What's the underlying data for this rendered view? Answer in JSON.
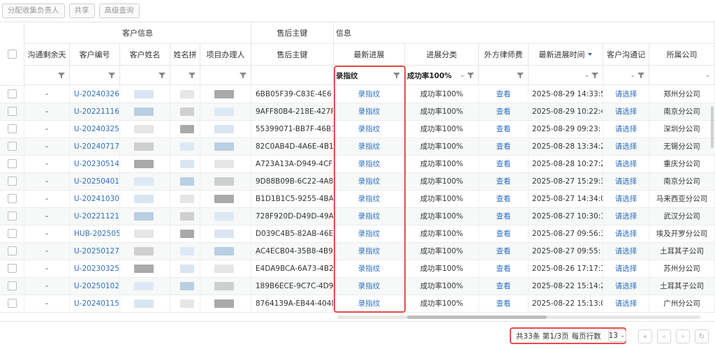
{
  "toolbar": {
    "assign_label": "分配收集负责人",
    "share_label": "共享",
    "advanced_query_label": "高级查询"
  },
  "header": {
    "group_customer": "客户信息",
    "group_aftersale_key": "售后主键",
    "group_info": "信息",
    "columns": {
      "communication_remaining": "沟通剩余天",
      "customer_no": "客户编号",
      "customer_name": "客户姓名",
      "name_pinyin": "姓名拼",
      "project_handler": "项目办理人",
      "aftersale_key": "售后主键",
      "latest_progress": "最新进展",
      "progress_category": "进展分类",
      "lawyer_fee": "外方律师费",
      "latest_progress_time": "最新进展时间",
      "customer_communication": "客户沟通记",
      "company": "所属公司"
    },
    "filters": {
      "latest_progress": "录指纹",
      "progress_category": "成功率100%"
    }
  },
  "rows": [
    {
      "remaining": "-",
      "customer_no": "U-20240326",
      "key": "6BB05F39-C83E-4E6",
      "progress": "录指纹",
      "category": "成功率100%",
      "fee": "查看",
      "time": "2025-08-29 14:33:5",
      "comm": "请选择",
      "company": "郑州分公司"
    },
    {
      "remaining": "-",
      "customer_no": "U-20221116",
      "key": "9AFF80B4-218E-427F",
      "progress": "录指纹",
      "category": "成功率100%",
      "fee": "查看",
      "time": "2025-08-29 10:22:4",
      "comm": "请选择",
      "company": "南京分公司"
    },
    {
      "remaining": "-",
      "customer_no": "U-20240325",
      "key": "55399071-BB7F-46B1",
      "progress": "录指纹",
      "category": "成功率100%",
      "fee": "查看",
      "time": "2025-08-29 09:23:",
      "comm": "请选择",
      "company": "深圳分公司"
    },
    {
      "remaining": "-",
      "customer_no": "U-20240717",
      "key": "82C0AB4D-4A6E-4B1",
      "progress": "录指纹",
      "category": "成功率100%",
      "fee": "查看",
      "time": "2025-08-28 13:34:2",
      "comm": "请选择",
      "company": "无锡分公司"
    },
    {
      "remaining": "-",
      "customer_no": "U-20230514",
      "key": "A723A13A-D949-4CF",
      "progress": "录指纹",
      "category": "成功率100%",
      "fee": "查看",
      "time": "2025-08-28 10:27:2",
      "comm": "请选择",
      "company": "重庆分公司"
    },
    {
      "remaining": "-",
      "customer_no": "U-20250401",
      "key": "9D88B09B-6C22-4A8",
      "progress": "录指纹",
      "category": "成功率100%",
      "fee": "查看",
      "time": "2025-08-27 15:29:3",
      "comm": "请选择",
      "company": "南京分公司"
    },
    {
      "remaining": "-",
      "customer_no": "U-20241030",
      "key": "B1D1B1C5-9255-4BA5",
      "progress": "录指纹",
      "category": "成功率100%",
      "fee": "查看",
      "time": "2025-08-27 14:34:0",
      "comm": "请选择",
      "company": "马来西亚分公司"
    },
    {
      "remaining": "-",
      "customer_no": "U-20221121",
      "key": "728F920D-D49D-49A",
      "progress": "录指纹",
      "category": "成功率100%",
      "fee": "查看",
      "time": "2025-08-27 10:30:1",
      "comm": "请选择",
      "company": "武汉分公司"
    },
    {
      "remaining": "-",
      "customer_no": "HUB-202505",
      "key": "D039C4B5-82AB-46E",
      "progress": "录指纹",
      "category": "成功率100%",
      "fee": "查看",
      "time": "2025-08-27 09:56:3",
      "comm": "请选择",
      "company": "埃及开罗分公司"
    },
    {
      "remaining": "-",
      "customer_no": "U-20250127",
      "key": "AC4ECB04-35B8-4B9",
      "progress": "录指纹",
      "category": "成功率100%",
      "fee": "查看",
      "time": "2025-08-27 09:55:",
      "comm": "请选择",
      "company": "土耳其子公司"
    },
    {
      "remaining": "-",
      "customer_no": "U-20230325",
      "key": "E4DA9BCA-6A73-4B2",
      "progress": "录指纹",
      "category": "成功率100%",
      "fee": "查看",
      "time": "2025-08-26 17:17:1",
      "comm": "请选择",
      "company": "苏州分公司"
    },
    {
      "remaining": "-",
      "customer_no": "U-20250102",
      "key": "189B6ECE-9C7C-4D9",
      "progress": "录指纹",
      "category": "成功率100%",
      "fee": "查看",
      "time": "2025-08-22 15:14:2",
      "comm": "请选择",
      "company": "土耳其子公司"
    },
    {
      "remaining": "-",
      "customer_no": "U-20240115",
      "key": "8764139A-EB44-404D",
      "progress": "录指纹",
      "category": "成功率100%",
      "fee": "查看",
      "time": "2025-08-22 15:13:0",
      "comm": "请选择",
      "company": "广州分公司"
    }
  ],
  "pager": {
    "summary": "共33条 第1/3页",
    "rows_per_page_label": "每页行数",
    "rows_per_page_value": "13"
  },
  "colors": {
    "link": "#2f6fbf",
    "highlight": "#e74c4c"
  },
  "icons": [
    "filter-icon",
    "chevron-down-icon",
    "sort-down-icon",
    "first-page-icon",
    "prev-page-icon",
    "next-page-icon",
    "refresh-icon"
  ]
}
